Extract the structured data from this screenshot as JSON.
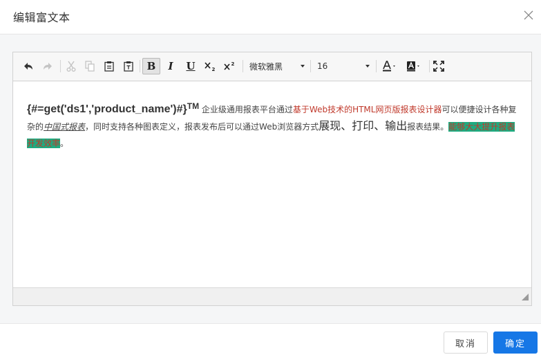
{
  "dialog": {
    "title": "编辑富文本",
    "close_icon": "close-icon"
  },
  "toolbar": {
    "icons": [
      "undo-icon",
      "redo-icon",
      "cut-icon",
      "copy-icon",
      "paste-icon",
      "paste-text-icon",
      "bold-icon",
      "italic-icon",
      "underline-icon",
      "subscript-icon",
      "superscript-icon",
      "font-color-icon",
      "background-color-icon",
      "fullscreen-icon"
    ],
    "bold_label": "B",
    "italic_label": "I",
    "underline_label": "U",
    "font_family": "微软雅黑",
    "font_size": "16",
    "colors": {
      "active_bg": "#e2e2e2"
    }
  },
  "content": {
    "expression": "{#=get('ds1','product_name')#}",
    "tm": "TM",
    "text1": "企业级通用报表平台通过",
    "red_text": "基于Web技术的HTML网页版报表设计器",
    "text2": "可以便捷设计各种复杂的",
    "italic_text": "中国式报表",
    "text3": "，同时支持各种图表定义，报表发布后可以通过Web浏览器方式",
    "large_text": "展现、打印、输出",
    "text4": "报表结果。",
    "highlight_text": "能够大大提升报表开发效率",
    "text5": "。",
    "colors": {
      "red": "#c0392b",
      "highlight_bg": "#1eab80"
    }
  },
  "footer": {
    "cancel_label": "取消",
    "ok_label": "确定",
    "colors": {
      "primary": "#1677e6"
    }
  }
}
